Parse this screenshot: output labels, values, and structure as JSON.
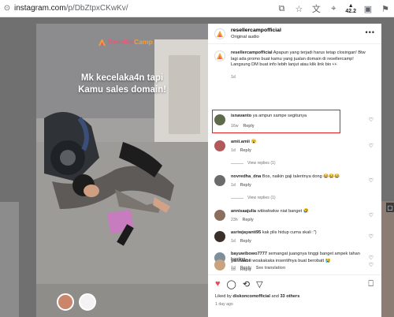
{
  "browser": {
    "url_prefix": "instagram.com",
    "url_path": "/p/DbZtpxCKwKv/",
    "indicator": "42.2"
  },
  "media": {
    "brand_name_1": "Reseller",
    "brand_name_2": "Camp",
    "headline_1": "Mk kecelaka4n tapi",
    "headline_2": "Kamu sales domain!",
    "colors": {
      "brand_pink": "#e35a7b",
      "brand_orange": "#f3a132"
    }
  },
  "post": {
    "username": "resellercampofficial",
    "audio": "Original audio",
    "more": "•••",
    "caption_user": "resellercampofficial",
    "caption_text": "Apapun yang terjadi harus tetap closingan! Btw lagi ada promo buat kamu yang jualan domain di resellercamp! Langsung DM buat info lebih lanjut atau klik link bio 👀",
    "caption_time": "1d"
  },
  "comments": [
    {
      "user": "isnavanto",
      "text": "ya ampun sampe segitunya",
      "time": "16w",
      "reply": "Reply",
      "extra": ""
    },
    {
      "user": "amii.amii",
      "text": "😮",
      "time": "1d",
      "reply": "Reply",
      "extra": "",
      "view_replies": "View replies (1)"
    },
    {
      "user": "novredha_dna",
      "text": "Bos, naikin gaji talentnya dong 😂😂😂",
      "time": "1d",
      "reply": "Reply",
      "extra": "",
      "view_replies": "View replies (1)"
    },
    {
      "user": "annisaajulia",
      "text": "wkkwkwkw niat banget 🤣",
      "time": "23h",
      "reply": "Reply",
      "extra": ""
    },
    {
      "user": "asriwjayanti95",
      "text": "kak plis hidup cuma skali :\")",
      "time": "1d",
      "reply": "Reply",
      "extra": ""
    },
    {
      "user": "bayuwibowo7777",
      "text": "semangat juangnya tinggi banget ampek tahan banting.",
      "time": "1d",
      "reply": "Reply",
      "extra": "See translation"
    },
    {
      "user": "yannaabii",
      "text": "woakakaka insentifnya buat berobatt 😭",
      "time": "1d",
      "reply": "Reply",
      "extra": ""
    }
  ],
  "actions": {
    "liked_prefix": "Liked by",
    "liked_user": "diskoncomofficial",
    "liked_and": "and",
    "liked_others": "33 others",
    "date": "1 day ago",
    "heart_color": "#ed4956"
  }
}
